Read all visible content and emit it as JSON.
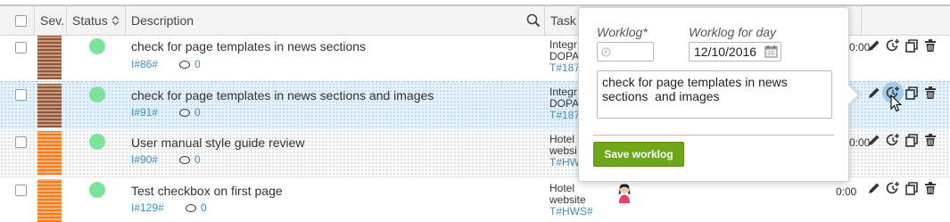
{
  "header": {
    "sev": "Sev.",
    "status": "Status",
    "description": "Description",
    "task": "Task"
  },
  "rows": [
    {
      "description": "check for page templates in news sections",
      "id": "I#86#",
      "comments": "0",
      "task_line1": "Integr",
      "task_line2": "DOPA",
      "task_link": "T#187",
      "time": "0:00"
    },
    {
      "description": "check for page templates in news sections and images",
      "id": "I#91#",
      "comments": "0",
      "task_line1": "Integr",
      "task_line2": "DOPA",
      "task_link": "T#187",
      "time": ""
    },
    {
      "description": "User manual style guide review",
      "id": "I#90#",
      "comments": "0",
      "task_line1": "Hotel",
      "task_line2": "websi",
      "task_link": "T#HW",
      "time": "0:00"
    },
    {
      "description": "Test checkbox on first page",
      "id": "I#129#",
      "comments": "0",
      "task_line1": "Hotel",
      "task_line2": "website",
      "task_link": "T#HWS#",
      "time": "0:00"
    }
  ],
  "popover": {
    "worklog_label": "Worklog*",
    "worklog_value": "",
    "worklog_day_label": "Worklog for day",
    "worklog_day_value": "12/10/2016",
    "note": "check for page templates in news sections  and images",
    "save_label": "Save worklog"
  },
  "colors": {
    "accent_green": "#6fa61a",
    "status_green": "#7be39a",
    "link_blue": "#3d8fc6",
    "sev_brown": "#8b5a3c",
    "sev_orange": "#ef7d22"
  }
}
